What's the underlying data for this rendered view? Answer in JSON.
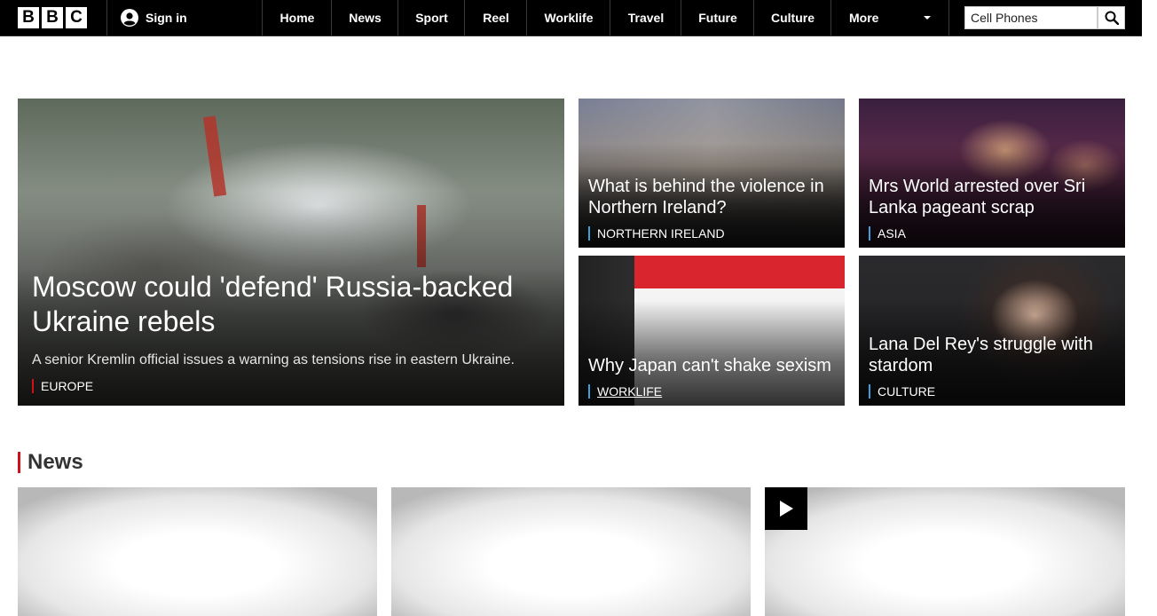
{
  "header": {
    "logo_letters": [
      "B",
      "B",
      "C"
    ],
    "sign_in_label": "Sign in",
    "nav": [
      "Home",
      "News",
      "Sport",
      "Reel",
      "Worklife",
      "Travel",
      "Future",
      "Culture",
      "More"
    ],
    "search": {
      "value": "Cell Phones"
    }
  },
  "hero": {
    "main": {
      "headline": "Moscow could 'defend' Russia-backed Ukraine rebels",
      "summary": "A senior Kremlin official issues a warning as tensions rise in eastern Ukraine.",
      "tag": "EUROPE"
    },
    "cards": [
      {
        "headline": "What is behind the violence in Northern Ireland?",
        "tag": "NORTHERN IRELAND"
      },
      {
        "headline": "Mrs World arrested over Sri Lanka pageant scrap",
        "tag": "ASIA"
      },
      {
        "headline": "Why Japan can't shake sexism",
        "tag": "WORKLIFE"
      },
      {
        "headline": "Lana Del Rey's struggle with stardom",
        "tag": "CULTURE"
      }
    ]
  },
  "news_section": {
    "title": "News"
  },
  "colors": {
    "accent_red": "#d1101a",
    "tag_blue": "#3f9fd8"
  }
}
